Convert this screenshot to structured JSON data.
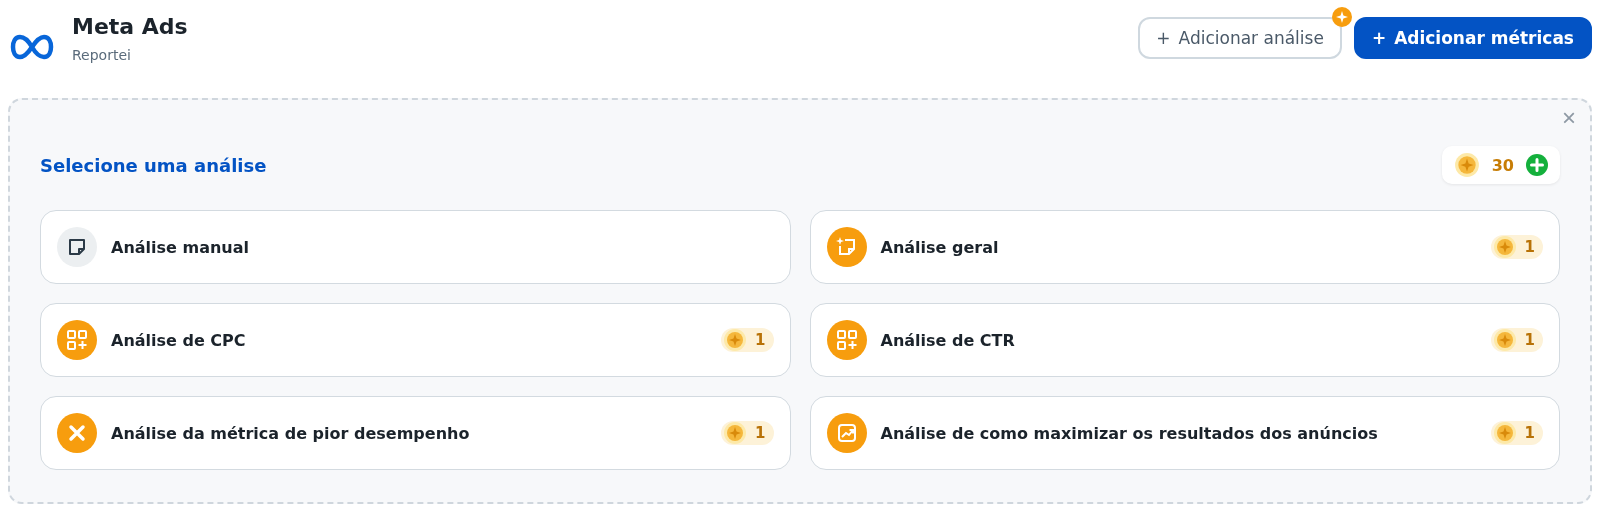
{
  "header": {
    "title": "Meta Ads",
    "subtitle": "Reportei"
  },
  "actions": [
    {
      "label": "Adicionar análise",
      "kind": "outline",
      "icon": "+",
      "badge": true
    },
    {
      "label": "Adicionar métricas",
      "kind": "primary",
      "icon": "+",
      "badge": false
    }
  ],
  "panel": {
    "title": "Selecione uma análise",
    "close": "×",
    "credits": "30",
    "options": [
      {
        "label": "Análise manual",
        "kind": "note"
      },
      {
        "label": "Análise geral",
        "kind": "sparkle-note",
        "cost": "1"
      },
      {
        "label": "Análise de CPC",
        "kind": "grid",
        "cost": "1"
      },
      {
        "label": "Análise de CTR",
        "kind": "grid",
        "cost": "1"
      },
      {
        "label": "Análise da métrica de pior desempenho",
        "kind": "cross",
        "cost": "1"
      },
      {
        "label": "Análise de como maximizar os resultados dos anúncios",
        "kind": "chart",
        "cost": "1"
      }
    ]
  }
}
